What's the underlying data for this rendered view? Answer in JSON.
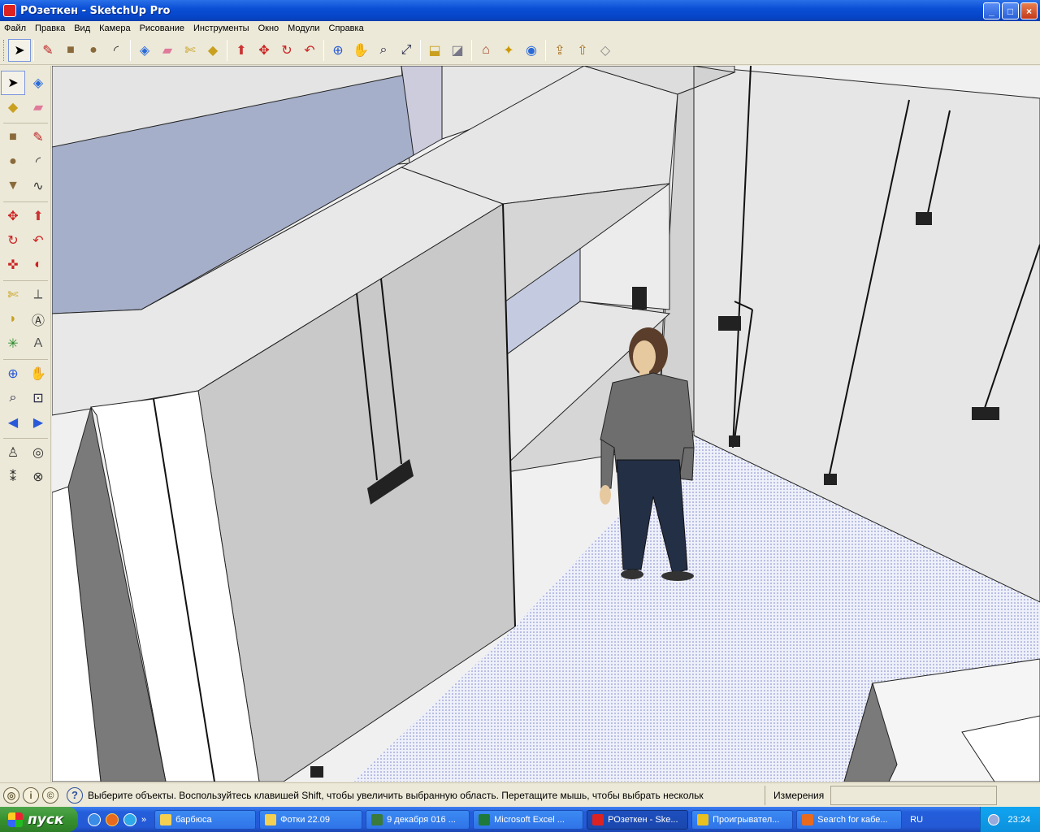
{
  "window": {
    "title": "РОзеткен - SketchUp Pro",
    "min_label": "_",
    "max_label": "□",
    "close_label": "×"
  },
  "menu": [
    "Файл",
    "Правка",
    "Вид",
    "Камера",
    "Рисование",
    "Инструменты",
    "Окно",
    "Модули",
    "Справка"
  ],
  "top_toolbar": [
    "select-icon",
    "pencil-line-icon",
    "rectangle-icon",
    "circle-icon",
    "arc-icon",
    "make-component-icon",
    "eraser-icon",
    "tape-measure-icon",
    "paint-bucket-icon",
    "push-pull-icon",
    "move-icon",
    "rotate-icon",
    "follow-me-icon",
    "orbit-icon",
    "pan-icon",
    "zoom-icon",
    "zoom-extents-icon",
    "add-location-icon",
    "toggle-terrain-icon",
    "get-models-icon",
    "add-photo-texture-icon",
    "google-earth-icon",
    "share-model-icon",
    "share-component-icon",
    "photo-textures-icon"
  ],
  "left_toolbar": [
    "select-icon",
    "make-component-icon",
    "paint-bucket-icon",
    "eraser-icon",
    "rectangle-icon",
    "pencil-line-icon",
    "circle-icon",
    "arc-icon",
    "polygon-icon",
    "freehand-icon",
    "move-icon",
    "push-pull-icon",
    "rotate-icon",
    "follow-me-icon",
    "scale-icon",
    "offset-icon",
    "tape-measure-icon",
    "dimension-icon",
    "protractor-icon",
    "text-label-icon",
    "axes-icon",
    "3d-text-icon",
    "orbit-icon",
    "pan-icon",
    "zoom-icon",
    "zoom-window-icon",
    "previous-view-icon",
    "next-view-icon",
    "position-camera-icon",
    "look-around-icon",
    "walk-icon",
    "section-plane-icon"
  ],
  "status": {
    "text": "Выберите объекты. Воспользуйтесь клавишей Shift, чтобы увеличить выбранную область. Перетащите мышь, чтобы выбрать нескольк",
    "measurements_label": "Измерения",
    "measurements_value": ""
  },
  "taskbar": {
    "start_label": "пуск",
    "items": [
      {
        "label": "барбюса",
        "icon": "folder-icon"
      },
      {
        "label": "Фотки 22.09",
        "icon": "folder-icon"
      },
      {
        "label": "9 декабря 016 ...",
        "icon": "image-viewer-icon"
      },
      {
        "label": "Microsoft Excel ...",
        "icon": "excel-icon"
      },
      {
        "label": "РОзеткен - Ske...",
        "icon": "sketchup-icon"
      },
      {
        "label": "Проигрывател...",
        "icon": "chrome-icon"
      },
      {
        "label": "Search for кабе...",
        "icon": "firefox-icon"
      }
    ],
    "active_index": 4,
    "language": "RU",
    "clock": "23:24"
  },
  "colors": {
    "xp_blue": "#245edb",
    "floor": "#e4e4f4",
    "wall_light": "#e8e8e8",
    "wall_grey": "#c9c9c9",
    "window_glass": "#aab3cc"
  }
}
